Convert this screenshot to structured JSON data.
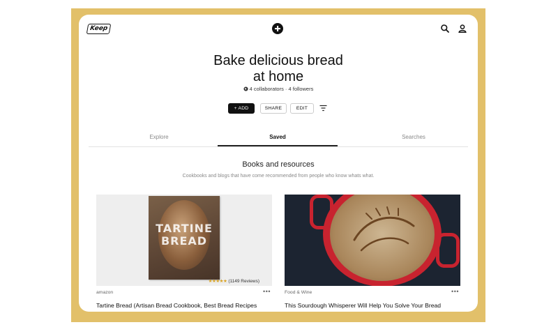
{
  "header": {
    "logo_text": "Keep",
    "icons": [
      "add-icon",
      "search-icon",
      "user-icon"
    ]
  },
  "collection": {
    "title_line1": "Bake delicious bread",
    "title_line2": "at home",
    "meta": "4 collaborators · 4 followers",
    "actions": {
      "add": "+ ADD",
      "share": "SHARE",
      "edit": "EDIT"
    }
  },
  "tabs": [
    {
      "label": "Explore"
    },
    {
      "label": "Saved",
      "active": true
    },
    {
      "label": "Searches"
    }
  ],
  "section": {
    "title": "Books and resources",
    "subtitle": "Cookbooks and blogs that have come recommended from people who know whats what."
  },
  "cards": [
    {
      "image_text_line1": "TARTINE",
      "image_text_line2": "BREAD",
      "rating_stars": "★★★★★",
      "rating": 4.5,
      "reviews": "(1149 Reviews)",
      "source": "amazon",
      "title": "Tartine Bread (Artisan Bread Cookbook, Best Bread Recipes"
    },
    {
      "source": "Food & Wine",
      "title": "This Sourdough Whisperer Will Help You Solve Your Bread Problems"
    }
  ],
  "colors": {
    "frame": "#e2c06a",
    "primary_button": "#111111",
    "pot_red": "#c8232f"
  }
}
